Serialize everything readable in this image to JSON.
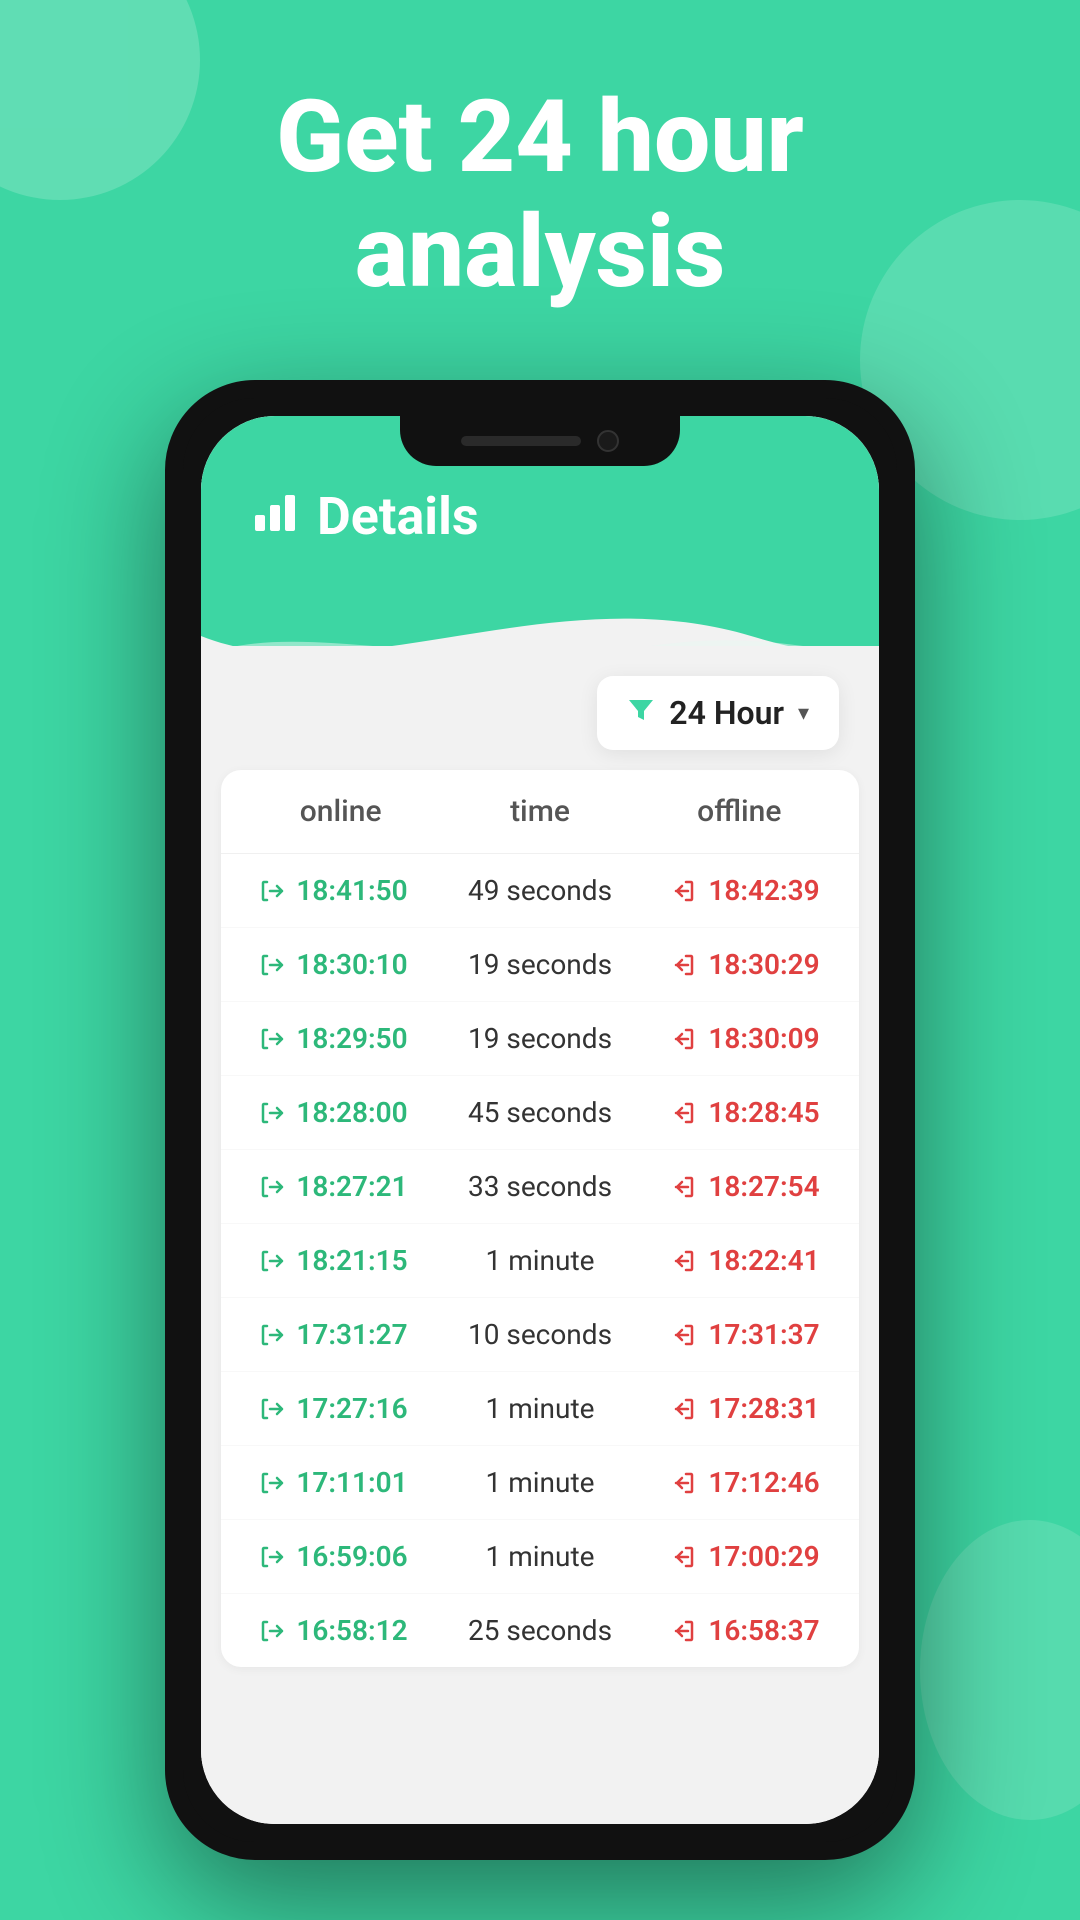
{
  "background_color": "#3dd6a3",
  "hero": {
    "title_line1": "Get 24 hour",
    "title_line2": "analysis"
  },
  "app": {
    "header": {
      "icon": "📊",
      "title": "Details"
    },
    "filter": {
      "label": "24 Hour",
      "icon": "▼"
    },
    "table": {
      "columns": [
        "online",
        "time",
        "offline"
      ],
      "rows": [
        {
          "online": "18:41:50",
          "duration": "49 seconds",
          "offline": "18:42:39"
        },
        {
          "online": "18:30:10",
          "duration": "19 seconds",
          "offline": "18:30:29"
        },
        {
          "online": "18:29:50",
          "duration": "19 seconds",
          "offline": "18:30:09"
        },
        {
          "online": "18:28:00",
          "duration": "45 seconds",
          "offline": "18:28:45"
        },
        {
          "online": "18:27:21",
          "duration": "33 seconds",
          "offline": "18:27:54"
        },
        {
          "online": "18:21:15",
          "duration": "1 minute",
          "offline": "18:22:41"
        },
        {
          "online": "17:31:27",
          "duration": "10 seconds",
          "offline": "17:31:37"
        },
        {
          "online": "17:27:16",
          "duration": "1 minute",
          "offline": "17:28:31"
        },
        {
          "online": "17:11:01",
          "duration": "1 minute",
          "offline": "17:12:46"
        },
        {
          "online": "16:59:06",
          "duration": "1 minute",
          "offline": "17:00:29"
        },
        {
          "online": "16:58:12",
          "duration": "25 seconds",
          "offline": "16:58:37"
        }
      ]
    }
  }
}
